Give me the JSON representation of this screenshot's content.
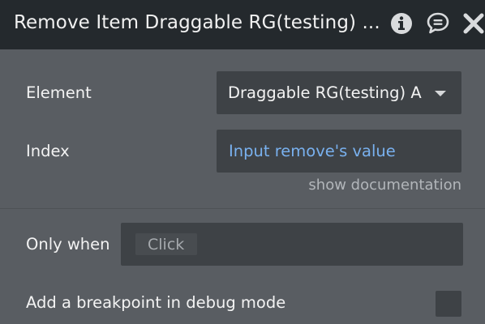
{
  "header": {
    "title": "Remove Item Draggable RG(testing) ...",
    "icons": [
      "info-icon",
      "comment-icon",
      "close-icon"
    ]
  },
  "element_row": {
    "label": "Element",
    "value": "Draggable RG(testing) A"
  },
  "index_row": {
    "label": "Index",
    "value": "Input remove's value"
  },
  "show_documentation": "show documentation",
  "only_when_row": {
    "label": "Only when",
    "value": "Click"
  },
  "breakpoint_row": {
    "label": "Add a breakpoint in debug mode",
    "checked": false
  },
  "colors": {
    "header_bg": "#24292d",
    "panel_bg": "#595d62",
    "field_bg": "#3e4246",
    "dynamic_text": "#79b1ef"
  }
}
